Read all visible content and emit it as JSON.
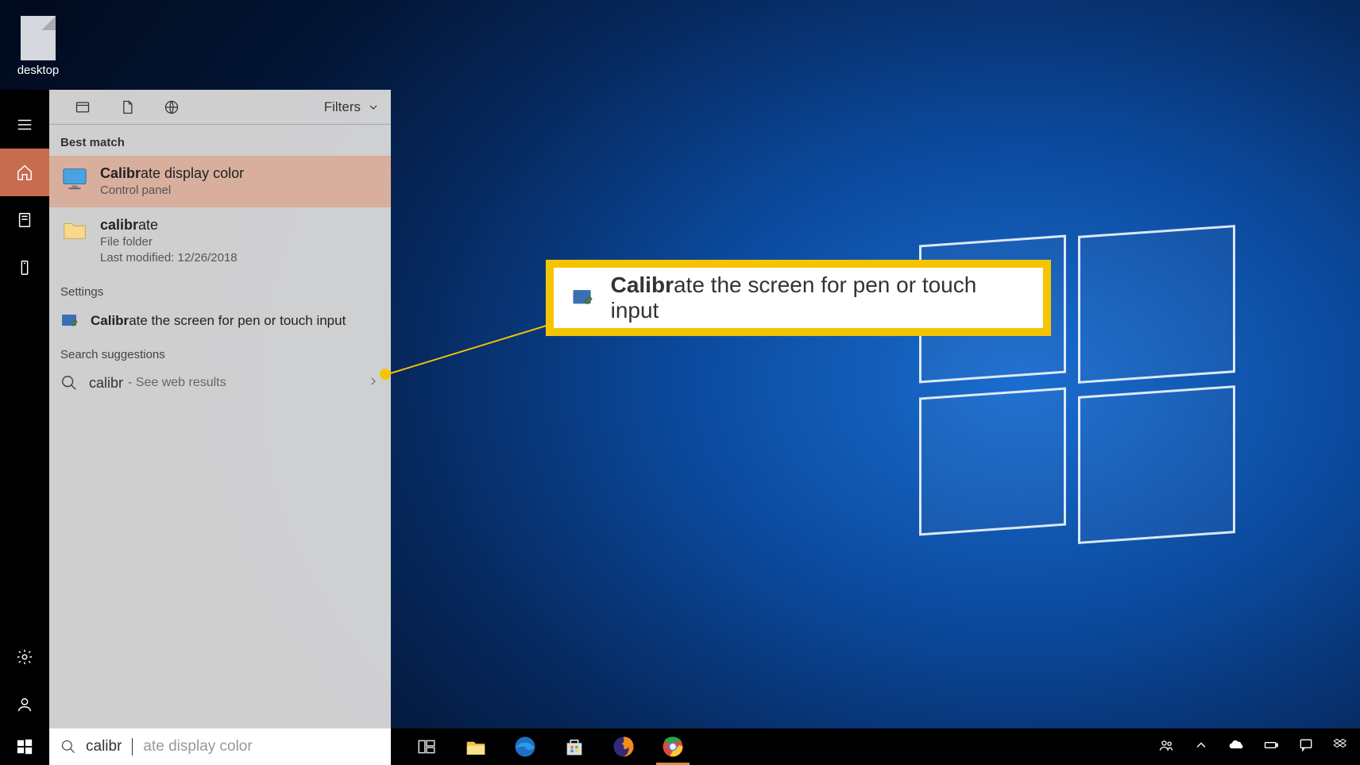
{
  "desktop": {
    "icon_label": "desktop"
  },
  "rail": {
    "items": [
      "menu",
      "home",
      "most-used",
      "devices"
    ],
    "bottom": [
      "settings",
      "account"
    ]
  },
  "panel": {
    "filters_label": "Filters",
    "sections": {
      "best_match": "Best match",
      "settings": "Settings",
      "search_suggestions": "Search suggestions"
    },
    "results": [
      {
        "title_bold": "Calibr",
        "title_rest": "ate display color",
        "subtitle": "Control panel"
      },
      {
        "title_bold": "calibr",
        "title_rest": "ate",
        "subtitle": "File folder",
        "subtitle2": "Last modified: 12/26/2018"
      }
    ],
    "settings_item": {
      "title_bold": "Calibr",
      "title_rest": "ate the screen for pen or touch input"
    },
    "suggestion": {
      "typed": "calibr",
      "hint": " - See web results"
    }
  },
  "callout": {
    "title_bold": "Calibr",
    "title_rest": "ate the screen for pen or touch input"
  },
  "searchbox": {
    "typed": "calibr",
    "ghost": "ate display color"
  },
  "taskbar": {
    "apps": [
      "task-view",
      "file-explorer",
      "edge",
      "store",
      "firefox",
      "chrome"
    ]
  },
  "tray": {
    "items": [
      "people",
      "up-chevron",
      "onedrive",
      "battery",
      "action-center",
      "dropbox"
    ]
  }
}
